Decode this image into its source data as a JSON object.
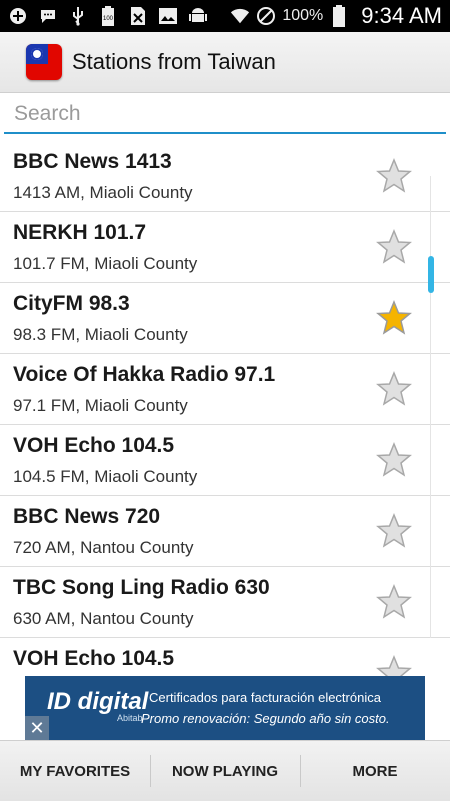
{
  "status_bar": {
    "left_icons": [
      "plus-box-icon",
      "chat-icon",
      "usb-icon",
      "battery-100-icon",
      "no-sim-icon",
      "image-icon",
      "android-icon"
    ],
    "right_icons": [
      "wifi-icon",
      "do-not-disturb-icon"
    ],
    "battery": "100%",
    "time": "9:34 AM"
  },
  "app_bar": {
    "title": "Stations from Taiwan",
    "flag_icon": "taiwan-flag-icon"
  },
  "search": {
    "placeholder": "Search",
    "value": ""
  },
  "stations": [
    {
      "name": "BBC News 1413",
      "detail": "1413 AM, Miaoli County",
      "favorite": false
    },
    {
      "name": "NERKH 101.7",
      "detail": "101.7 FM, Miaoli County",
      "favorite": false
    },
    {
      "name": "CityFM 98.3",
      "detail": "98.3 FM, Miaoli County",
      "favorite": true
    },
    {
      "name": "Voice Of Hakka Radio 97.1",
      "detail": "97.1 FM, Miaoli County",
      "favorite": false
    },
    {
      "name": "VOH Echo 104.5",
      "detail": "104.5 FM, Miaoli County",
      "favorite": false
    },
    {
      "name": "BBC News 720",
      "detail": "720 AM, Nantou County",
      "favorite": false
    },
    {
      "name": "TBC Song Ling Radio 630",
      "detail": "630 AM, Nantou County",
      "favorite": false
    },
    {
      "name": "VOH Echo 104.5",
      "detail": "",
      "favorite": false
    }
  ],
  "ad": {
    "brand": "ID digital",
    "brand_sub": "Abitab",
    "line1": "Certificados para facturación electrónica",
    "line2": "Promo renovación: Segundo año sin costo.",
    "close": "✕"
  },
  "tabs": {
    "favorites": "MY FAVORITES",
    "now_playing": "NOW PLAYING",
    "more": "MORE"
  },
  "colors": {
    "accent": "#1f8fc9",
    "scroll_thumb": "#33b5e5",
    "star_fav": "#f5b400",
    "star_empty": "#c8c8c8"
  }
}
